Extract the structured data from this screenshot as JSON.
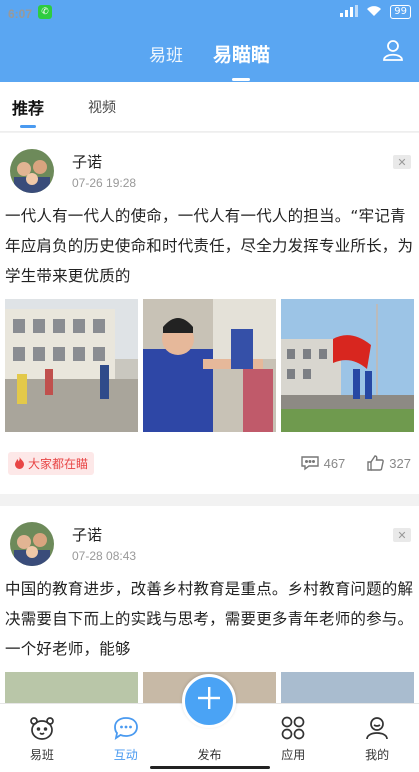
{
  "status": {
    "time": "6:07",
    "battery": "99"
  },
  "header": {
    "tab_left": "易班",
    "tab_active": "易瞄瞄"
  },
  "subtabs": {
    "recommend": "推荐",
    "video": "视频"
  },
  "posts": [
    {
      "name": "子诺",
      "time": "07-26 19:28",
      "text": "一代人有一代人的使命，一代人有一代人的担当。“牢记青年应肩负的历史使命和时代责任，尽全力发挥专业所长，为学生带来更优质的",
      "hot_label": "大家都在瞄",
      "comments": "467",
      "likes": "327"
    },
    {
      "name": "子诺",
      "time": "07-28 08:43",
      "text": "中国的教育进步，改善乡村教育是重点。乡村教育问题的解决需要自下而上的实践与思考，需要更多青年老师的参与。一个好老师，能够"
    }
  ],
  "bottom_nav": {
    "home": "易班",
    "interact": "互动",
    "publish": "发布",
    "apps": "应用",
    "mine": "我的"
  },
  "colors": {
    "accent": "#5aa6f2",
    "active": "#4a9af0",
    "hot": "#e84646"
  }
}
